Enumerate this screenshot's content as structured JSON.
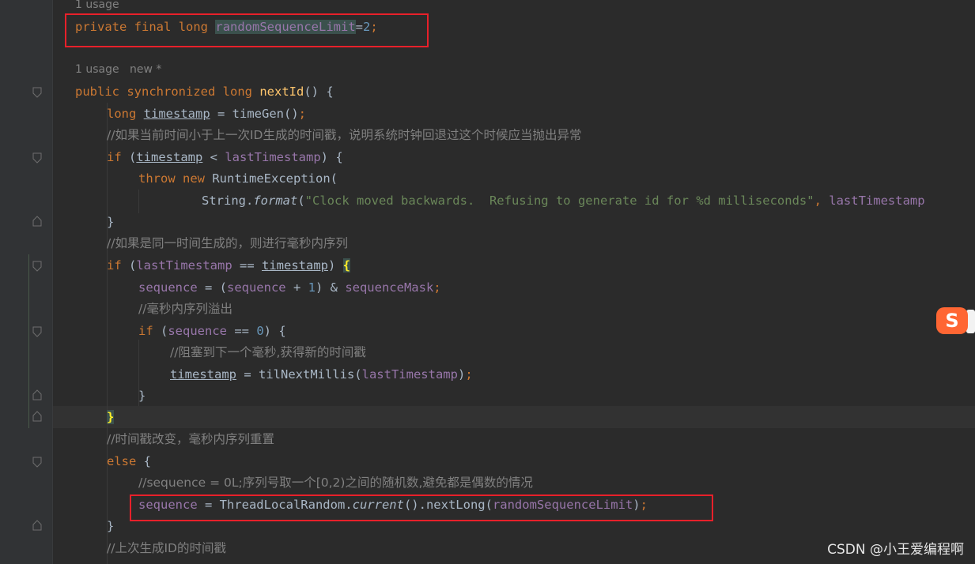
{
  "editor": {
    "hint_usage_top": "1 usage",
    "hint_usage_method": "1 usage",
    "hint_new": "new *",
    "lines": {
      "l1": {
        "kw1": "private",
        "kw2": "final",
        "kw3": "long",
        "field": "randomSequenceLimit",
        "op": "=",
        "num": "2",
        "semi": ";"
      },
      "l2": {
        "kw1": "public",
        "kw2": "synchronized",
        "kw3": "long",
        "fn": "nextId",
        "rest": "() {"
      },
      "l3": {
        "kw": "long",
        "var": "timestamp",
        "rest": " = timeGen()",
        "semi": ";"
      },
      "l4": {
        "comment": "//如果当前时间小于上一次ID生成的时间戳，说明系统时钟回退过这个时候应当抛出异常"
      },
      "l5": {
        "kw": "if",
        "a": " (",
        "var": "timestamp",
        "b": " < ",
        "field": "lastTimestamp",
        "c": ") {"
      },
      "l6": {
        "kw1": "throw",
        "kw2": "new",
        "rest": " RuntimeException("
      },
      "l7": {
        "cls": "String.",
        "fn": "format",
        "a": "(",
        "str": "\"Clock moved backwards.  Refusing to generate id for %d milliseconds\"",
        "comma": ", ",
        "field": "lastTimestamp"
      },
      "l8": {
        "text": "}"
      },
      "l9": {
        "comment": "//如果是同一时间生成的，则进行毫秒内序列"
      },
      "l10": {
        "kw": "if",
        "a": " (",
        "field": "lastTimestamp",
        "b": " == ",
        "var": "timestamp",
        "c": ") ",
        "brace": "{"
      },
      "l11": {
        "field1": "sequence",
        "a": " = (",
        "field2": "sequence",
        "b": " + ",
        "num": "1",
        "c": ") & ",
        "field3": "sequenceMask",
        "semi": ";"
      },
      "l12": {
        "comment": "//毫秒内序列溢出"
      },
      "l13": {
        "kw": "if",
        "a": " (",
        "field": "sequence",
        "b": " == ",
        "num": "0",
        "c": ") {"
      },
      "l14": {
        "comment": "//阻塞到下一个毫秒,获得新的时间戳"
      },
      "l15": {
        "var": "timestamp",
        "a": " = tilNextMillis(",
        "field": "lastTimestamp",
        "b": ")",
        "semi": ";"
      },
      "l16": {
        "text": "}"
      },
      "l17": {
        "brace": "}"
      },
      "l18": {
        "comment": "//时间戳改变，毫秒内序列重置"
      },
      "l19": {
        "kw": "else",
        "rest": " {"
      },
      "l20": {
        "comment": "//sequence = 0L;序列号取一个[0,2)之间的随机数,避免都是偶数的情况"
      },
      "l21": {
        "field1": "sequence",
        "a": " = ThreadLocalRandom.",
        "fn": "current",
        "b": "().nextLong(",
        "field2": "randomSequenceLimit",
        "c": ")",
        "semi": ";"
      },
      "l22": {
        "text": "}"
      },
      "l23": {
        "comment": "//上次生成ID的时间戳"
      }
    }
  },
  "watermark": "CSDN @小王爱编程啊",
  "ime_badge": "S",
  "colors": {
    "keyword": "#cc7832",
    "field": "#9876aa",
    "number": "#6897bb",
    "string": "#6a8759",
    "method": "#ffc66d",
    "comment": "#808080",
    "annotation_box": "#e8202a"
  }
}
